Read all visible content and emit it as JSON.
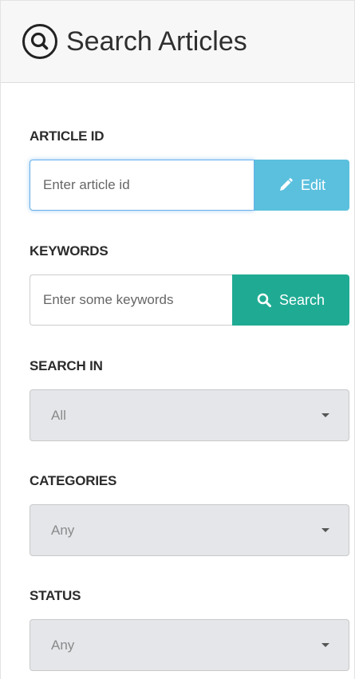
{
  "header": {
    "title": "Search Articles",
    "icon": "search-circle-icon"
  },
  "article_id": {
    "label": "ARTICLE ID",
    "placeholder": "Enter article id",
    "button_label": "Edit",
    "button_icon": "pencil-icon",
    "button_color": "#5bc0de"
  },
  "keywords": {
    "label": "KEYWORDS",
    "placeholder": "Enter some keywords",
    "button_label": "Search",
    "button_icon": "search-icon",
    "button_color": "#1fab93"
  },
  "search_in": {
    "label": "SEARCH IN",
    "selected": "All"
  },
  "categories": {
    "label": "CATEGORIES",
    "selected": "Any"
  },
  "status": {
    "label": "STATUS",
    "selected": "Any"
  }
}
